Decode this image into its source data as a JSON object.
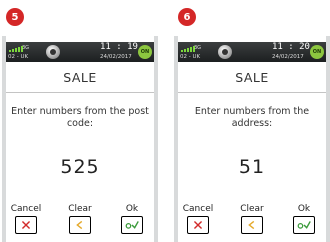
{
  "panels": [
    {
      "step": "5",
      "status": {
        "network": "3G",
        "carrier": "02 - UK",
        "time": "11 : 19",
        "date": "24/02/2017",
        "battery_label": "ON"
      },
      "title": "SALE",
      "prompt": "Enter numbers from the post code:",
      "value": "525",
      "keys": {
        "cancel": "Cancel",
        "clear": "Clear",
        "ok": "Ok"
      }
    },
    {
      "step": "6",
      "status": {
        "network": "3G",
        "carrier": "02 - UK",
        "time": "11 : 20",
        "date": "24/02/2017",
        "battery_label": "ON"
      },
      "title": "SALE",
      "prompt": "Enter numbers from the address:",
      "value": "51",
      "keys": {
        "cancel": "Cancel",
        "clear": "Clear",
        "ok": "Ok"
      }
    }
  ],
  "colors": {
    "badge": "#d42727",
    "cancel": "#d22b2b",
    "clear": "#e5a92a",
    "ok": "#3b9a3b",
    "statusbar": "#2a2d2e"
  },
  "icons": [
    "signal-icon",
    "globe-icon",
    "battery-icon",
    "cancel-x-icon",
    "clear-arrow-icon",
    "ok-check-icon"
  ]
}
